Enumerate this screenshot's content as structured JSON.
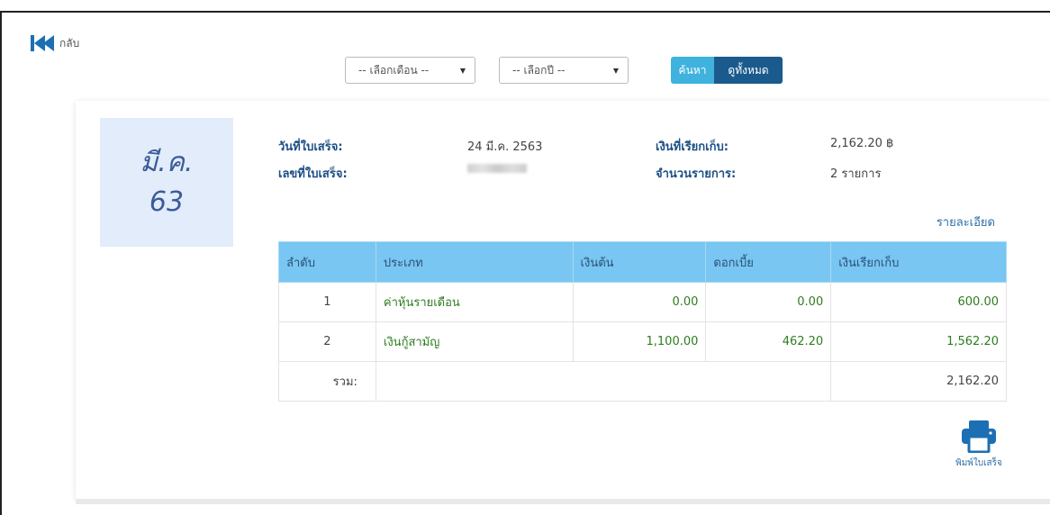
{
  "nav": {
    "back_label": "กลับ"
  },
  "filters": {
    "month_placeholder": "-- เลือกเดือน --",
    "year_placeholder": "-- เลือกปี --",
    "search_label": "ค้นหา",
    "view_all_label": "ดูทั้งหมด"
  },
  "receipt": {
    "month_short": "มี.ค.",
    "year_short": "63",
    "date_label": "วันที่ใบเสร็จ:",
    "date_value": "24 มี.ค. 2563",
    "number_label": "เลขที่ใบเสร็จ:",
    "amount_label": "เงินที่เรียกเก็บ:",
    "amount_value": "2,162.20 ฿",
    "count_label": "จำนวนรายการ:",
    "count_value": "2 รายการ",
    "detail_link": "รายละเอียด"
  },
  "table": {
    "headers": [
      "ลำดับ",
      "ประเภท",
      "เงินต้น",
      "ดอกเบี้ย",
      "เงินเรียกเก็บ"
    ],
    "rows": [
      {
        "no": "1",
        "type": "ค่าหุ้นรายเดือน",
        "principal": "0.00",
        "interest": "0.00",
        "charged": "600.00"
      },
      {
        "no": "2",
        "type": "เงินกู้สามัญ",
        "principal": "1,100.00",
        "interest": "462.20",
        "charged": "1,562.20"
      }
    ],
    "total_label": "รวม:",
    "total_value": "2,162.20"
  },
  "print": {
    "label": "พิมพ์ใบเสร็จ"
  },
  "colors": {
    "accent_light": "#3fb2dd",
    "accent_dark": "#1b5a8c",
    "header_bg": "#78c6f1",
    "amount_green": "#2e7d1f"
  }
}
